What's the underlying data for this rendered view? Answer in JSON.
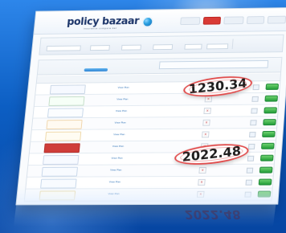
{
  "brand": {
    "name": "policy bazaar",
    "tagline": "insurance compare kar"
  },
  "topbar": {
    "actions": [
      "",
      "",
      "",
      "",
      ""
    ]
  },
  "search": {
    "title": "",
    "fields": [
      "",
      "",
      "",
      "",
      "",
      ""
    ],
    "contact": {
      "label": "",
      "number": ""
    }
  },
  "results": {
    "title": "",
    "notice": "",
    "headers": [
      "",
      "",
      "",
      "",
      "",
      ""
    ],
    "rows": [
      {
        "logo": "",
        "logo_color": "#2d4f8f",
        "feature": "",
        "premium": ""
      },
      {
        "logo": "",
        "logo_color": "#2b8c48",
        "feature": "",
        "premium": ""
      },
      {
        "logo": "",
        "logo_color": "#3d77b5",
        "feature": "",
        "premium": ""
      },
      {
        "logo": "",
        "logo_color": "#e29b2f",
        "feature": "",
        "premium": ""
      },
      {
        "logo": "",
        "logo_color": "#d4a12d",
        "feature": "",
        "premium": ""
      },
      {
        "logo": "",
        "logo_color": "#cf3d39",
        "feature": "",
        "premium": ""
      },
      {
        "logo": "",
        "logo_color": "#274a95",
        "feature": "",
        "premium": ""
      },
      {
        "logo": "",
        "logo_color": "#2f6caa",
        "feature": "",
        "premium": ""
      },
      {
        "logo": "",
        "logo_color": "#3276ba",
        "feature": "",
        "premium": ""
      },
      {
        "logo": "",
        "logo_color": "#c2a43a",
        "feature": "",
        "premium": ""
      }
    ]
  },
  "prices": {
    "first": "1230.34",
    "second": "2022.48"
  },
  "colors": {
    "background_blue": "#0c5ec3",
    "accent_red": "#e14d4d",
    "buy_green": "#239e39",
    "link_blue": "#2e72b7"
  },
  "icons": {
    "brand_mark": "blue-circle-icon",
    "checkbox": "checkbox-icon",
    "compare": "compare-box-icon"
  }
}
